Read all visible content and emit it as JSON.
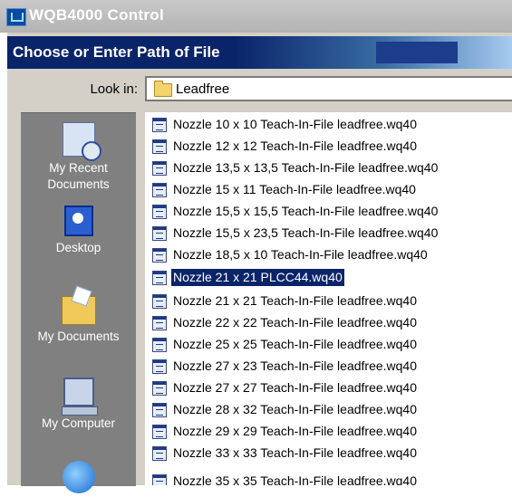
{
  "window": {
    "title": "WQB4000 Control"
  },
  "dialog": {
    "title": "Choose or Enter Path of File"
  },
  "look_in": {
    "label": "Look in:",
    "value": "Leadfree"
  },
  "places": [
    {
      "label": "My Recent Documents",
      "icon": "recent-documents-icon"
    },
    {
      "label": "Desktop",
      "icon": "desktop-icon"
    },
    {
      "label": "My Documents",
      "icon": "my-documents-icon"
    },
    {
      "label": "My Computer",
      "icon": "my-computer-icon"
    },
    {
      "label": "",
      "icon": "network-places-icon"
    }
  ],
  "files": [
    {
      "name": "Nozzle 10 x 10 Teach-In-File leadfree.wq40",
      "selected": false
    },
    {
      "name": "Nozzle 12 x 12 Teach-In-File leadfree.wq40",
      "selected": false
    },
    {
      "name": "Nozzle 13,5 x 13,5 Teach-In-File leadfree.wq40",
      "selected": false
    },
    {
      "name": "Nozzle 15 x 11 Teach-In-File leadfree.wq40",
      "selected": false
    },
    {
      "name": "Nozzle 15,5 x 15,5 Teach-In-File leadfree.wq40",
      "selected": false
    },
    {
      "name": "Nozzle 15,5 x 23,5 Teach-In-File leadfree.wq40",
      "selected": false
    },
    {
      "name": "Nozzle 18,5 x 10 Teach-In-File leadfree.wq40",
      "selected": false
    },
    {
      "name": "Nozzle 21 x 21 PLCC44.wq40",
      "selected": true
    },
    {
      "name": "Nozzle 21 x 21 Teach-In-File leadfree.wq40",
      "selected": false
    },
    {
      "name": "Nozzle 22 x 22 Teach-In-File leadfree.wq40",
      "selected": false
    },
    {
      "name": "Nozzle 25 x 25 Teach-In-File leadfree.wq40",
      "selected": false
    },
    {
      "name": "Nozzle 27 x 23 Teach-In-File leadfree.wq40",
      "selected": false
    },
    {
      "name": "Nozzle 27 x 27 Teach-In-File leadfree.wq40",
      "selected": false
    },
    {
      "name": "Nozzle 28 x 32 Teach-In-File leadfree.wq40",
      "selected": false
    },
    {
      "name": "Nozzle 29 x 29 Teach-In-File leadfree.wq40",
      "selected": false
    },
    {
      "name": "Nozzle 33 x 33 Teach-In-File leadfree.wq40",
      "selected": false
    },
    {
      "name": "Nozzle 35 x 35 Teach-In-File leadfree.wq40",
      "selected": false
    }
  ],
  "colors": {
    "selection": "#0a246a",
    "places_bar": "#808080",
    "dialog_title": "#0a246a"
  }
}
